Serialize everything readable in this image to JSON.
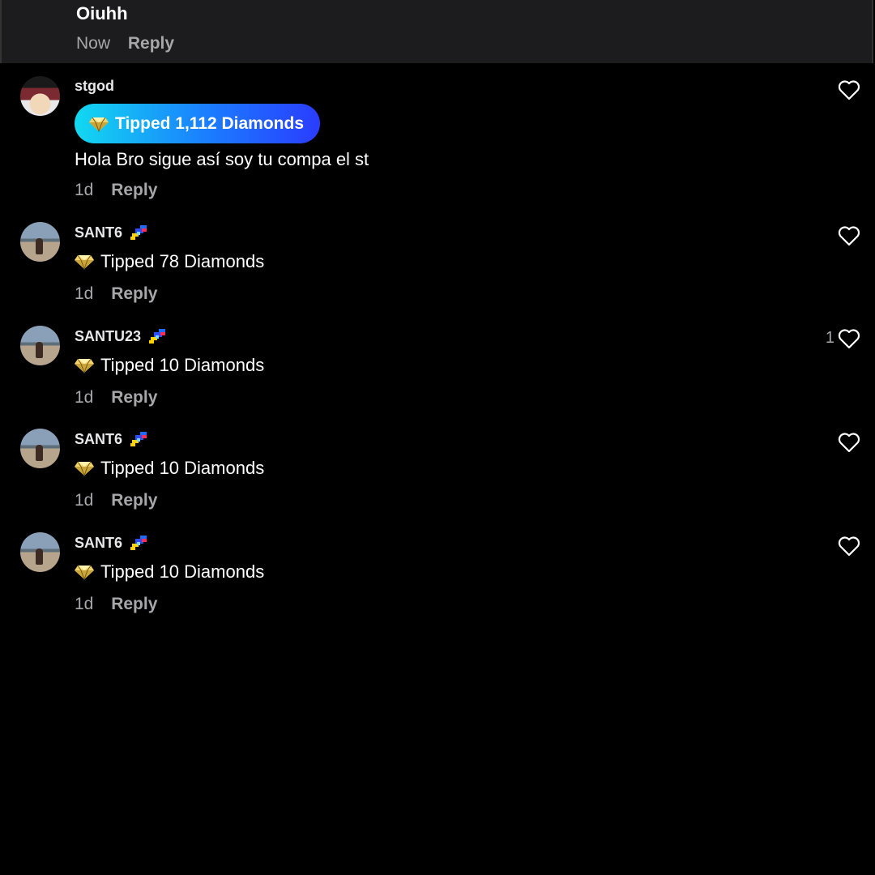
{
  "top_comment": {
    "text": "Oiuhh",
    "time": "Now",
    "reply": "Reply"
  },
  "comments": [
    {
      "username": "stgod",
      "tip": "Tipped 1,112 Diamonds",
      "text": "Hola Bro sigue así soy tu compa el st",
      "time": "1d",
      "reply": "Reply",
      "likes": "",
      "avatar": "dragonball-character-avatar",
      "badge": ""
    },
    {
      "username": "SANT6",
      "tip": "Tipped 78 Diamonds",
      "time": "1d",
      "reply": "Reply",
      "likes": "",
      "avatar": "beach-photo-avatar",
      "badge": "pixel-rocket-badge"
    },
    {
      "username": "SANTU23",
      "tip": "Tipped 10 Diamonds",
      "time": "1d",
      "reply": "Reply",
      "likes": "1",
      "avatar": "beach-photo-avatar",
      "badge": "pixel-rocket-badge"
    },
    {
      "username": "SANT6",
      "tip": "Tipped 10 Diamonds",
      "time": "1d",
      "reply": "Reply",
      "likes": "",
      "avatar": "beach-photo-avatar",
      "badge": "pixel-rocket-badge"
    },
    {
      "username": "SANT6",
      "tip": "Tipped 10 Diamonds",
      "time": "1d",
      "reply": "Reply",
      "likes": "",
      "avatar": "beach-photo-avatar",
      "badge": "pixel-rocket-badge"
    }
  ],
  "icons": {
    "heart": "heart-outline-icon",
    "diamond": "diamond-icon"
  },
  "colors": {
    "background": "#000000",
    "top_comment_bg": "#1c1c1e",
    "muted": "#a7a7ab",
    "tip_gradient_start": "#12d9f0",
    "tip_gradient_end": "#2a3cff"
  }
}
